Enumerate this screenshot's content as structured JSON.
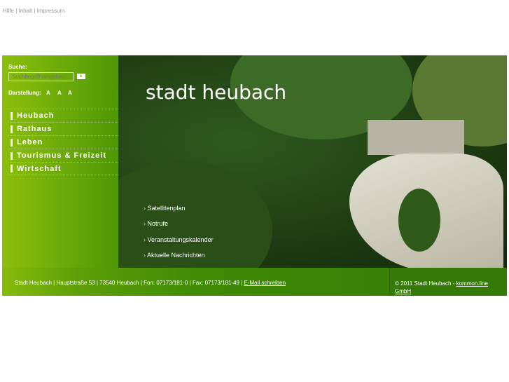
{
  "top_links": [
    "Hilfe",
    "Inhalt",
    "Impressum"
  ],
  "search": {
    "label": "Suche:",
    "placeholder": "Suchbegriff eingeben",
    "button": "▸"
  },
  "font_size": {
    "label": "Darstellung:",
    "options": [
      "A",
      "A",
      "A"
    ]
  },
  "nav": [
    "Heubach",
    "Rathaus",
    "Leben",
    "Tourismus & Freizeit",
    "Wirtschaft"
  ],
  "logo": "stadt heubach",
  "quick_links": [
    "Satellitenplan",
    "Notrufe",
    "Veranstaltungskalender",
    "Aktuelle Nachrichten"
  ],
  "footer": {
    "address": "Stadt Heubach | Hauptstraße 53 | 73540 Heubach | Fon: 07173/181-0 | Fax: 07173/181-49 | ",
    "email_link": "E-Mail schreiben",
    "copyright": "© 2011 Stadt Heubach - ",
    "company_link": "kommon.line GmbH"
  }
}
